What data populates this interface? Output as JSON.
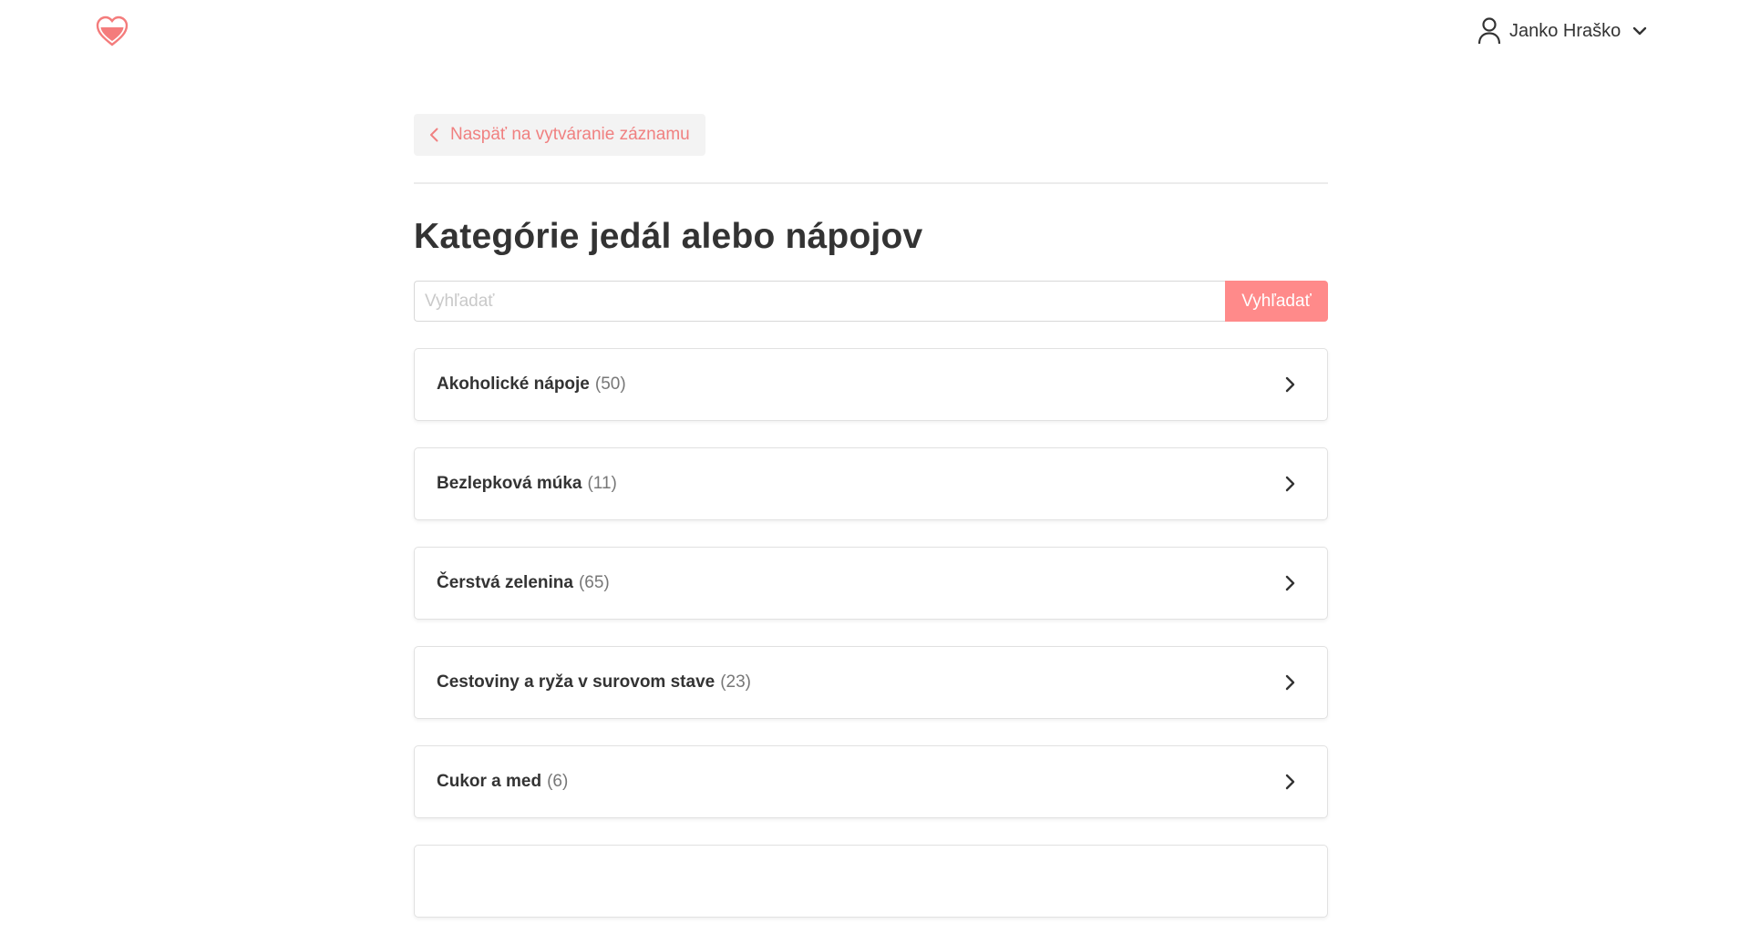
{
  "header": {
    "user_name": "Janko Hraško",
    "logo_icon": "heart-icon",
    "user_icon": "user-icon",
    "menu_icon": "chevron-down-icon"
  },
  "main": {
    "back_label": "Naspäť na vytváranie záznamu",
    "title": "Kategórie jedál alebo nápojov",
    "search": {
      "placeholder": "Vyhľadať",
      "value": "",
      "button_label": "Vyhľadať"
    },
    "categories": [
      {
        "label": "Akoholické nápoje",
        "count": "(50)"
      },
      {
        "label": "Bezlepková múka",
        "count": "(11)"
      },
      {
        "label": "Čerstvá zelenina",
        "count": "(65)"
      },
      {
        "label": "Cestoviny a ryža v surovom stave",
        "count": "(23)"
      },
      {
        "label": "Cukor a med",
        "count": "(6)"
      },
      {
        "label": "",
        "count": ""
      }
    ]
  },
  "colors": {
    "accent": "#ff8a8a",
    "accent_text": "#f08080",
    "logo": "#f47c7c"
  }
}
